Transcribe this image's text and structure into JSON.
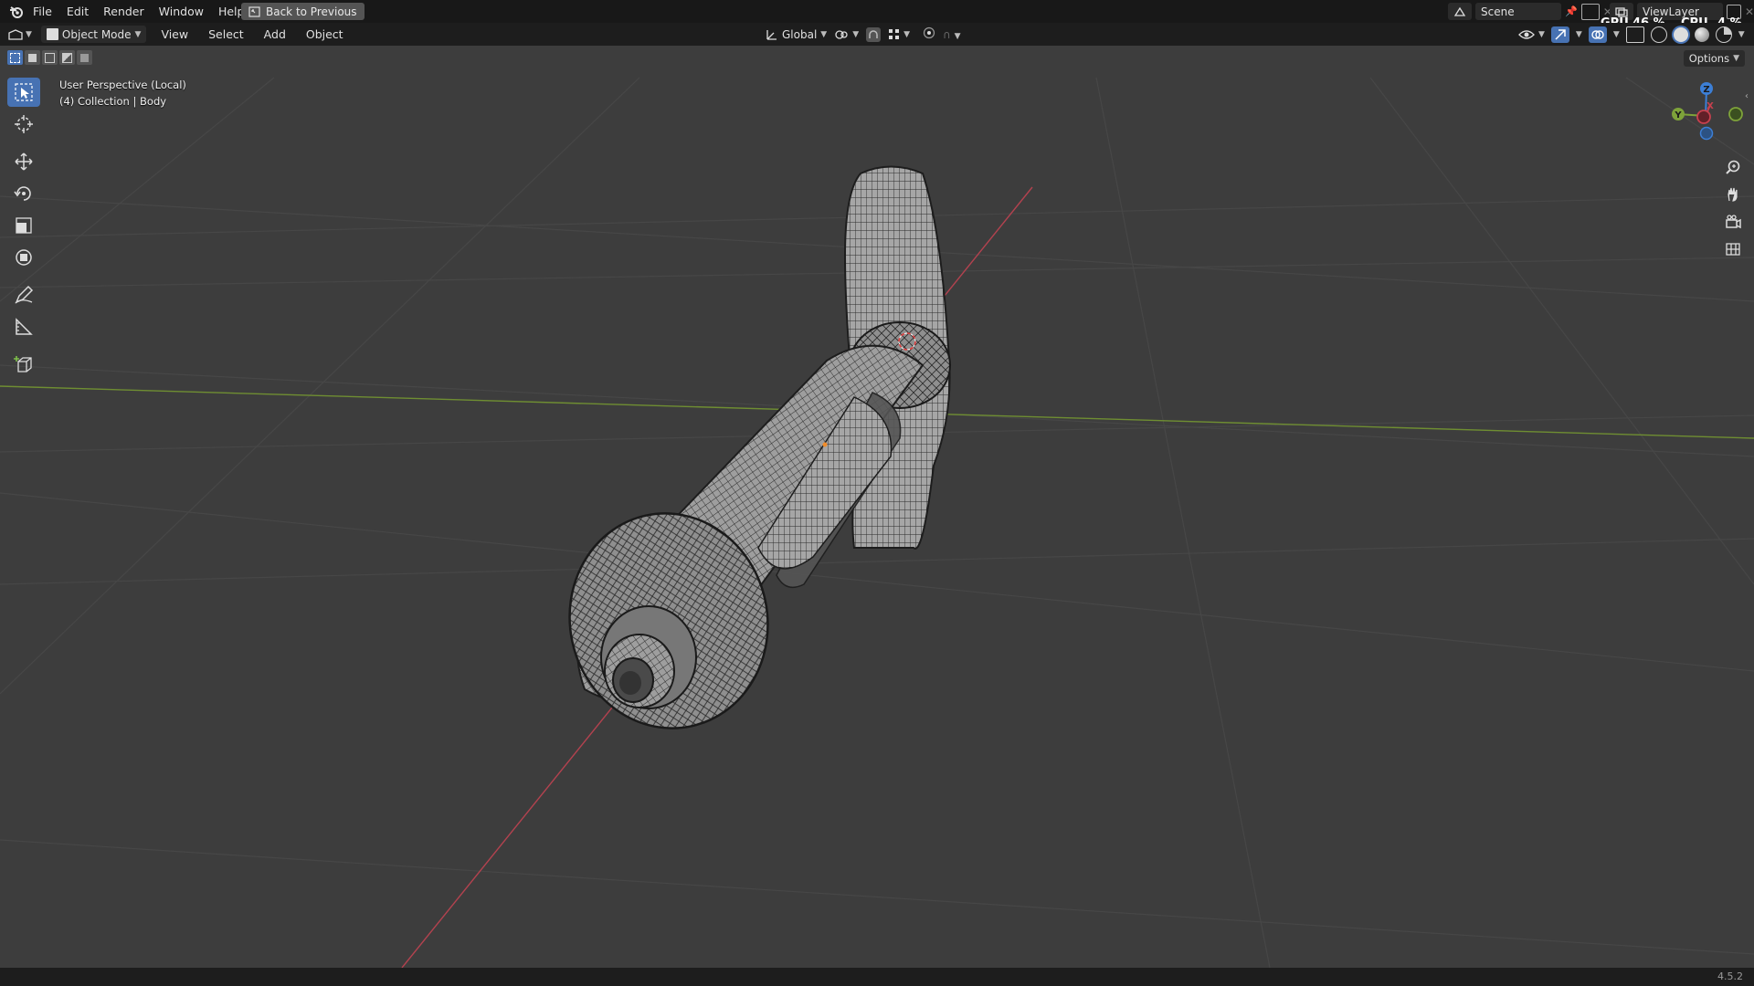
{
  "menu": {
    "items": [
      "File",
      "Edit",
      "Render",
      "Window",
      "Help"
    ],
    "back_label": "Back to Previous"
  },
  "header": {
    "mode": "Object Mode",
    "menus": [
      "View",
      "Select",
      "Add",
      "Object"
    ],
    "orientation": "Global",
    "options_label": "Options"
  },
  "topright": {
    "scene": "Scene",
    "view_layer": "ViewLayer",
    "gpu_label": "GPU",
    "gpu_value": "46 %",
    "cpu_label": "CPU",
    "cpu_value": "4 %"
  },
  "viewport": {
    "perspective": "User Perspective (Local)",
    "collection": "(4) Collection | Body"
  },
  "gizmo": {
    "z": "Z",
    "y": "Y",
    "x": "X"
  },
  "status": {
    "version": "4.5.2"
  },
  "colors": {
    "accent": "#4772b3",
    "x_axis": "#c8404e",
    "y_axis": "#7ea33a",
    "z_axis": "#3c7fd6"
  }
}
